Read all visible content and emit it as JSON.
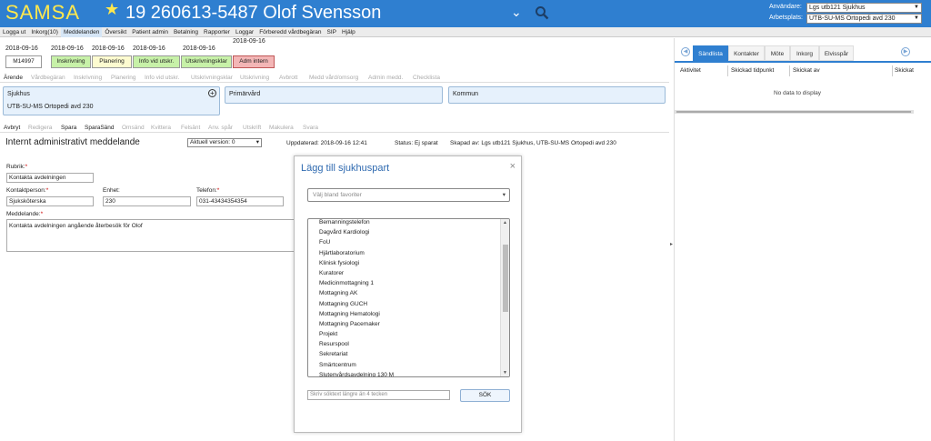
{
  "header": {
    "brand": "SAMSA",
    "patient": "19 260613-5487 Olof Svensson",
    "user_label": "Användare:",
    "user_value": "Lgs utb121 Sjukhus",
    "workplace_label": "Arbetsplats:",
    "workplace_value": "UTB-SU-MS Ortopedi avd 230"
  },
  "menu": [
    "Logga ut",
    "Inkorg(10)",
    "Meddelanden",
    "Översikt",
    "Patient admin",
    "Betalning",
    "Rapporter",
    "Loggar",
    "Förberedd vårdbegäran",
    "SIP",
    "Hjälp"
  ],
  "process": {
    "case_id": "M14997",
    "case_date": "2018-09-16",
    "steps": [
      {
        "date": "2018-09-16",
        "label": "Inskrivning"
      },
      {
        "date": "2018-09-16",
        "label": "Planering"
      },
      {
        "date": "2018-09-16",
        "label": "Info vid utskr."
      },
      {
        "date": "2018-09-16",
        "label": "Utskrivningsklar"
      },
      {
        "date": "2018-09-16",
        "label": "Adm intern"
      }
    ]
  },
  "case_tabs": [
    "Ärende",
    "Vårdbegäran",
    "Inskrivning",
    "Planering",
    "Info vid utskr.",
    "Utskrivningsklar",
    "Utskrivning",
    "Avbrott",
    "Medd vård/omsorg",
    "Admin medd.",
    "Checklista"
  ],
  "parties": {
    "sjukhus": "Sjukhus",
    "sjukhus_unit": "UTB-SU-MS Ortopedi avd 230",
    "primarvard": "Primärvård",
    "kommun": "Kommun"
  },
  "actions": [
    "Avbryt",
    "Redigera",
    "Spara",
    "SparaSänd",
    "Omsänd",
    "Kvittera",
    "Felsänt",
    "Anv. spår",
    "Utskrift",
    "Makulera",
    "Svara"
  ],
  "message": {
    "title": "Internt administrativt meddelande",
    "version": "Aktuell version: 0",
    "updated": "Uppdaterad: 2018-09-16 12:41",
    "status": "Status: Ej sparat",
    "created_by": "Skapad av: Lgs utb121 Sjukhus, UTB-SU-MS Ortopedi avd 230"
  },
  "form": {
    "rubrik_label": "Rubrik:",
    "rubrik_value": "Kontakta avdelningen",
    "kontakt_label": "Kontaktperson:",
    "kontakt_value": "Sjuksköterska",
    "enhet_label": "Enhet:",
    "enhet_value": "230",
    "telefon_label": "Telefon:",
    "telefon_value": "031-43434354354",
    "meddelande_label": "Meddelande:",
    "meddelande_value": "Kontakta avdelningen angående återbesök för Olof",
    "req": "*"
  },
  "modal": {
    "title": "Lägg till sjukhuspart",
    "close": "×",
    "favorites_placeholder": "Välj bland favoriter",
    "items": [
      "Bemanningstelefon",
      "Dagvård Kardiologi",
      "FoU",
      "Hjärtlaboratorium",
      "Klinisk fysiologi",
      "Kuratorer",
      "Medicinmottagning 1",
      "Mottagning AK",
      "Mottagning GUCH",
      "Mottagning Hematologi",
      "Mottagning Pacemaker",
      "Projekt",
      "Resurspool",
      "Sekretariat",
      "Smärtcentrum",
      "Slutenvårdsavdelning 130 M"
    ],
    "search_placeholder": "Skriv söktext längre än 4 tecken",
    "search_button": "SÖK"
  },
  "right": {
    "tabs": [
      "Sändlista",
      "Kontakter",
      "Möte",
      "Inkorg",
      "Elvisspår"
    ],
    "columns": [
      "Aktivitet",
      "Skickad tidpunkt",
      "Skickat av",
      "Skickat"
    ],
    "empty": "No data to display"
  },
  "colors": {
    "header": "#2f7fd0",
    "brand": "#ffe84d",
    "step_green": "#c7f1a8",
    "step_yellow": "#fdfbd0",
    "step_red": "#f3b6b6",
    "party_bg": "#e6f1fc"
  }
}
